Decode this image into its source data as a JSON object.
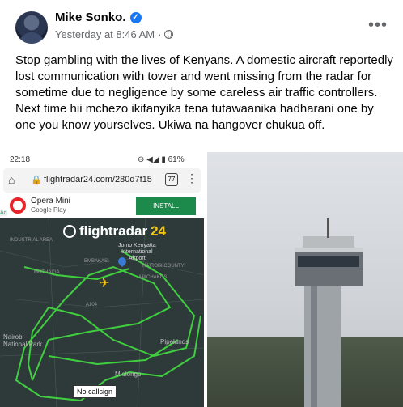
{
  "post": {
    "author": "Mike Sonko.",
    "timestamp": "Yesterday at 8:46 AM",
    "separator": "·",
    "caption": "Stop gambling with the lives of Kenyans. A domestic aircraft reportedly lost communication with tower and went missing from the radar for sometime due to   negligence by some careless air traffic controllers. Next time hii mchezo ikifanyika tena tutawaanika hadharani one by one you know yourselves. Ukiwa na hangover chukua off.",
    "more_icon": "more-horizontal-icon",
    "verified_icon": "verified-badge-icon",
    "privacy_icon": "globe-icon"
  },
  "screenshot": {
    "status_time": "22:18",
    "status_right": "⊖ ◀◢ ▮ 61%",
    "url": "flightradar24.com/280d7f15",
    "tab_count": "77",
    "ad_name": "Opera Mini",
    "ad_sub": "Google Play",
    "ad_button": "INSTALL",
    "ad_badge": "Ad",
    "logo_text": "flightradar",
    "logo_num": "24",
    "airport": "Jomo Kenyatta\nInternational\nAirport",
    "callsign": "No callsign",
    "labels": [
      "INDUSTRIAL AREA",
      "EMBAKASI",
      "MUTHAIGA",
      "NAIROBI COUNTY",
      "MACHAKOS",
      "Nairobi\nNational Park",
      "Pipelands",
      "Mlolongo",
      "A104"
    ]
  },
  "colors": {
    "track": "#3fcf3f",
    "accent": "#1877f2",
    "install": "#1c8a4b"
  }
}
